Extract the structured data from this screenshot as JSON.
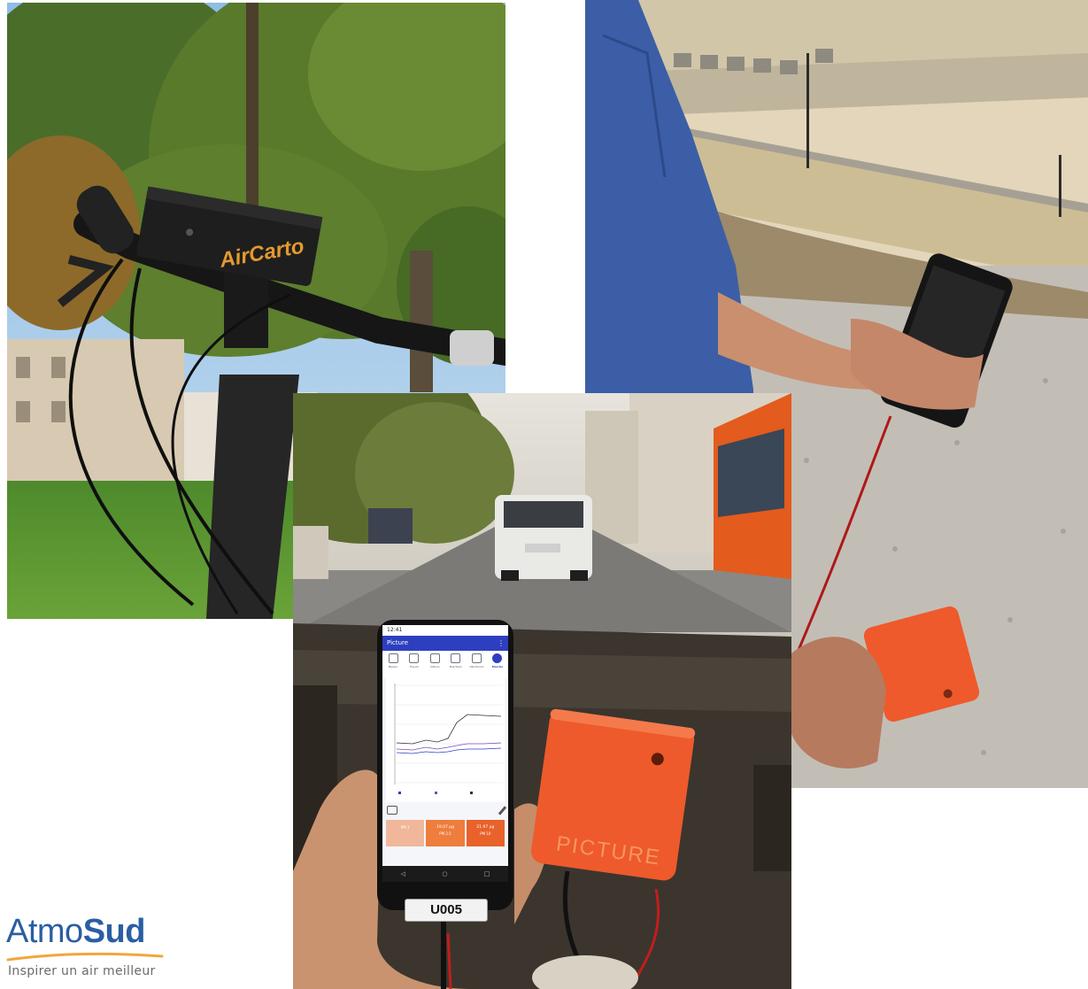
{
  "photos": {
    "bike": {
      "device_brand": "AirCarto",
      "device_type": "bike handlebar air sensor"
    },
    "site": {
      "device_type": "orange sensor connected to smartphone"
    },
    "car": {
      "device_type": "phone app with orange Picture sensor",
      "phone_label": "U005"
    }
  },
  "phone": {
    "status_time": "12:41",
    "app_title": "Picture",
    "menu_icon": "kebab-menu-icon",
    "modes": [
      {
        "label": "Maison",
        "icon": "home-icon"
      },
      {
        "label": "Travail",
        "icon": "clock-icon"
      },
      {
        "label": "Voiture",
        "icon": "car-icon"
      },
      {
        "label": "Bus/Tram",
        "icon": "bus-icon"
      },
      {
        "label": "Vélo/Scoot",
        "icon": "bike-icon"
      },
      {
        "label": "Marche",
        "icon": "walk-icon",
        "active": true
      }
    ],
    "pm_cards": [
      {
        "value": "",
        "label": "PM 1"
      },
      {
        "value": "19.07 µg",
        "label": "PM 2.5"
      },
      {
        "value": "21.97 µg",
        "label": "PM 10"
      }
    ],
    "label": "U005"
  },
  "sensor_brand": "PICTURE",
  "logo": {
    "word_part1": "Atmo",
    "word_part2": "Sud",
    "tagline": "Inspirer un air meilleur",
    "color_primary": "#2a5ea3",
    "color_swoosh": "#f2a63a"
  },
  "colors": {
    "sensor_orange": "#ee5a2b",
    "app_blue": "#2d3fbf"
  }
}
